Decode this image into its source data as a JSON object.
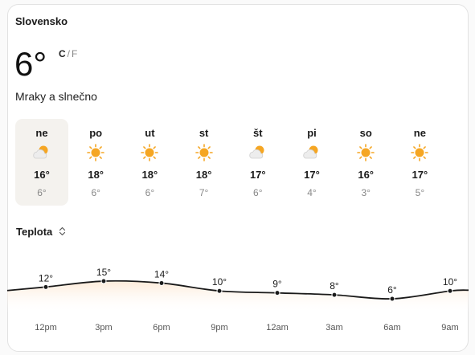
{
  "location": "Slovensko",
  "current": {
    "temp": "6°",
    "unit_c": "C",
    "unit_sep": "/",
    "unit_f": "F",
    "condition": "Mraky a slnečno"
  },
  "days": [
    {
      "name": "ne",
      "icon": "partly-sunny-icon",
      "hi": "16°",
      "lo": "6°",
      "selected": true
    },
    {
      "name": "po",
      "icon": "sunny-icon",
      "hi": "18°",
      "lo": "6°"
    },
    {
      "name": "ut",
      "icon": "sunny-icon",
      "hi": "18°",
      "lo": "6°"
    },
    {
      "name": "st",
      "icon": "sunny-icon",
      "hi": "18°",
      "lo": "7°"
    },
    {
      "name": "št",
      "icon": "partly-sunny-icon",
      "hi": "17°",
      "lo": "6°"
    },
    {
      "name": "pi",
      "icon": "partly-sunny-icon",
      "hi": "17°",
      "lo": "4°"
    },
    {
      "name": "so",
      "icon": "sunny-icon",
      "hi": "16°",
      "lo": "3°"
    },
    {
      "name": "ne",
      "icon": "sunny-icon",
      "hi": "17°",
      "lo": "5°"
    }
  ],
  "metric": {
    "label": "Teplota"
  },
  "chart_data": {
    "type": "area",
    "categories": [
      "12pm",
      "3pm",
      "6pm",
      "9pm",
      "12am",
      "3am",
      "6am",
      "9am"
    ],
    "values": [
      12,
      15,
      14,
      10,
      9,
      8,
      6,
      10
    ],
    "value_labels": [
      "12°",
      "15°",
      "14°",
      "10°",
      "9°",
      "8°",
      "6°",
      "10°"
    ]
  },
  "colors": {
    "sun": "#f5a623",
    "cloud": "#e6e6e6",
    "area": "#fde9d6",
    "line": "#1a1a1a",
    "selected_bg": "#f4f2ee"
  }
}
